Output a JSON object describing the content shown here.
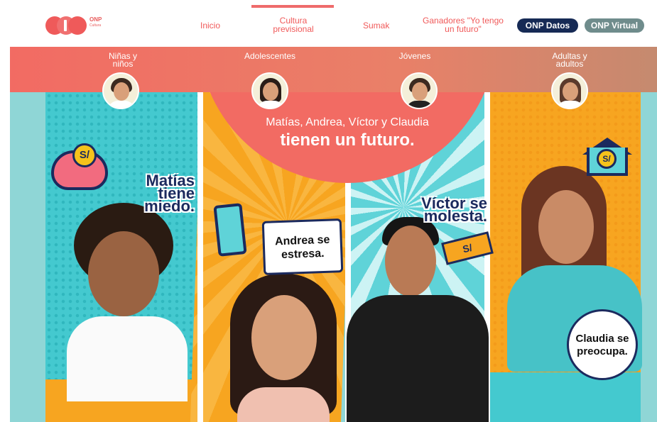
{
  "logo": {
    "name": "ONP",
    "sub": "Cultura"
  },
  "nav": {
    "inicio": "Inicio",
    "cultura": "Cultura previsional",
    "sumak": "Sumak",
    "ganadores": "Ganadores \"Yo tengo un futuro\"",
    "datos": "ONP Datos",
    "virtual": "ONP Virtual"
  },
  "tabs": {
    "ninos": "Niñas y niños",
    "adolescentes": "Adolescentes",
    "jovenes": "Jóvenes",
    "adultos": "Adultas y adultos"
  },
  "hero": {
    "line1": "Matías, Andrea, Víctor y Claudia",
    "line2": "tienen un futuro.",
    "matias": "Matías tiene miedo.",
    "andrea": "Andrea se estresa.",
    "victor": "Víctor se molesta.",
    "claudia": "Claudia se preocupa.",
    "currency": "S/"
  },
  "colors": {
    "accent": "#f05a5a",
    "navy": "#162a55",
    "teal": "#44c9cf",
    "orange": "#f7a520",
    "band": "#f26b63"
  },
  "icons": [
    "piggy-bank-icon",
    "coin-icon",
    "phone-icon",
    "money-bill-icon",
    "house-icon"
  ]
}
